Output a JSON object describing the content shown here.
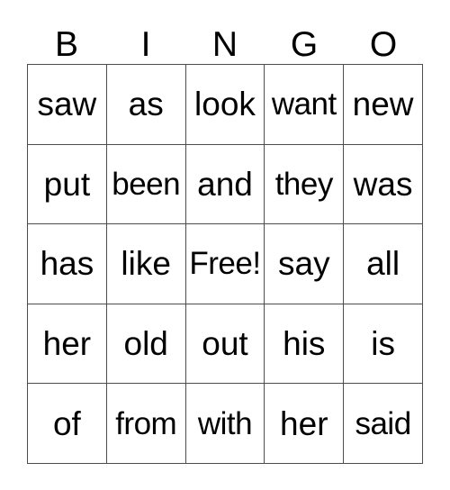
{
  "card": {
    "title": "BINGO",
    "columns": [
      "B",
      "I",
      "N",
      "G",
      "O"
    ],
    "free_space_label": "Free!",
    "colors": {
      "background": "#ffffff",
      "text": "#000000",
      "grid_line": "#4d4d4d"
    },
    "rows": [
      {
        "cells": [
          {
            "text": "saw",
            "free": false
          },
          {
            "text": "as",
            "free": false
          },
          {
            "text": "look",
            "free": false
          },
          {
            "text": "want",
            "free": false
          },
          {
            "text": "new",
            "free": false
          }
        ]
      },
      {
        "cells": [
          {
            "text": "put",
            "free": false
          },
          {
            "text": "been",
            "free": false
          },
          {
            "text": "and",
            "free": false
          },
          {
            "text": "they",
            "free": false
          },
          {
            "text": "was",
            "free": false
          }
        ]
      },
      {
        "cells": [
          {
            "text": "has",
            "free": false
          },
          {
            "text": "like",
            "free": false
          },
          {
            "text": "Free!",
            "free": true
          },
          {
            "text": "say",
            "free": false
          },
          {
            "text": "all",
            "free": false
          }
        ]
      },
      {
        "cells": [
          {
            "text": "her",
            "free": false
          },
          {
            "text": "old",
            "free": false
          },
          {
            "text": "out",
            "free": false
          },
          {
            "text": "his",
            "free": false
          },
          {
            "text": "is",
            "free": false
          }
        ]
      },
      {
        "cells": [
          {
            "text": "of",
            "free": false
          },
          {
            "text": "from",
            "free": false
          },
          {
            "text": "with",
            "free": false
          },
          {
            "text": "her",
            "free": false
          },
          {
            "text": "said",
            "free": false
          }
        ]
      }
    ]
  }
}
